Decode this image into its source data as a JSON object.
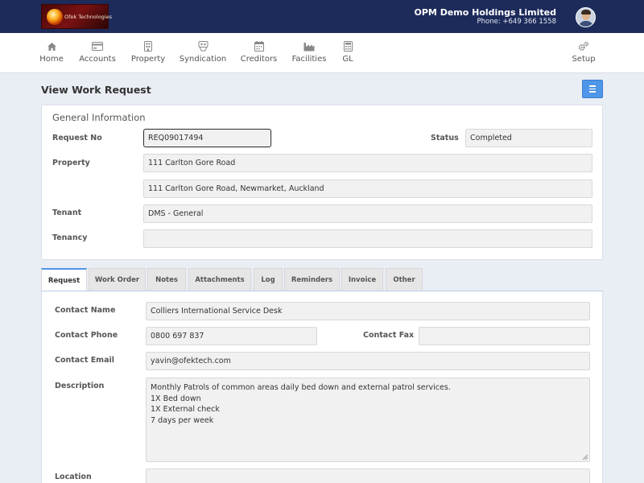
{
  "header": {
    "logo_text": "Ofek Technologies",
    "company_name": "OPM Demo Holdings Limited",
    "phone": "Phone: +649 366 1558"
  },
  "nav": {
    "items": [
      {
        "label": "Home",
        "icon": "home-icon"
      },
      {
        "label": "Accounts",
        "icon": "credit-card-icon"
      },
      {
        "label": "Property",
        "icon": "building-icon"
      },
      {
        "label": "Syndication",
        "icon": "syndication-icon"
      },
      {
        "label": "Creditors",
        "icon": "calendar-icon"
      },
      {
        "label": "Facilities",
        "icon": "industry-icon"
      },
      {
        "label": "GL",
        "icon": "calculator-icon"
      },
      {
        "label": "Setup",
        "icon": "gears-icon"
      }
    ]
  },
  "page": {
    "title": "View Work Request"
  },
  "general": {
    "section_title": "General Information",
    "request_no_label": "Request No",
    "request_no": "REQ09017494",
    "status_label": "Status",
    "status": "Completed",
    "property_label": "Property",
    "property": "111 Carlton Gore Road",
    "property_address": "111 Carlton Gore Road, Newmarket, Auckland",
    "tenant_label": "Tenant",
    "tenant": "DMS - General",
    "tenancy_label": "Tenancy",
    "tenancy": ""
  },
  "tabs": [
    {
      "label": "Request"
    },
    {
      "label": "Work Order"
    },
    {
      "label": "Notes"
    },
    {
      "label": "Attachments"
    },
    {
      "label": "Log"
    },
    {
      "label": "Reminders"
    },
    {
      "label": "Invoice"
    },
    {
      "label": "Other"
    }
  ],
  "request": {
    "contact_name_label": "Contact Name",
    "contact_name": "Colliers International Service Desk",
    "contact_phone_label": "Contact Phone",
    "contact_phone": "0800 697 837",
    "contact_fax_label": "Contact Fax",
    "contact_fax": "",
    "contact_email_label": "Contact Email",
    "contact_email": "yavin@ofektech.com",
    "description_label": "Description",
    "description_lines": [
      "Monthly Patrols of common areas daily bed down and external patrol services.",
      "1X Bed down",
      "1X External check",
      "7 days per week"
    ],
    "location_label": "Location",
    "location": ""
  },
  "colors": {
    "topbar": "#1d2b5b",
    "accent": "#4f95e8",
    "background": "#e9edf4"
  }
}
